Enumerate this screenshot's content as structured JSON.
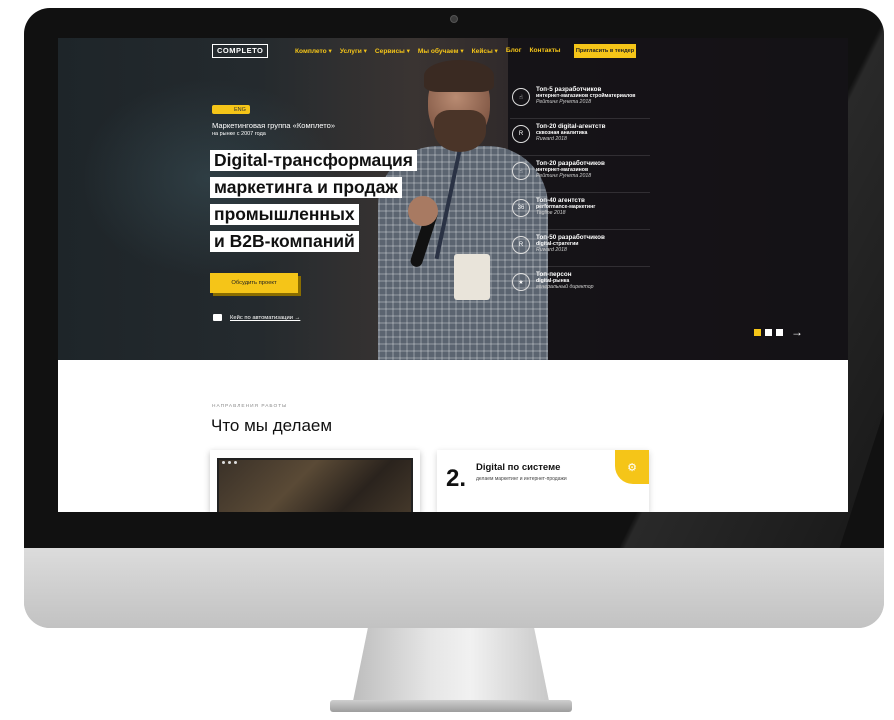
{
  "nav": {
    "logo": "COMPLETO",
    "items": [
      "Комплето ▾",
      "Услуги ▾",
      "Сервисы ▾",
      "Мы обучаем ▾",
      "Кейсы ▾",
      "Блог",
      "Контакты"
    ],
    "cta": "Пригласить в тендер"
  },
  "hero": {
    "lang": "ENG",
    "tagline": "Маркетинговая группа «Комплето»",
    "since": "на рынке с 2007 года",
    "headline": [
      "Digital-трансформация",
      "маркетинга и продаж",
      "промышленных",
      "и B2B-компаний"
    ],
    "cta": "Обсудить проект",
    "case_link": "Кейс по автоматизации →"
  },
  "awards": [
    {
      "icon": "hand-award-icon",
      "glyph": "☝",
      "title": "Топ-5 разработчиков",
      "desc": "интернет-магазинов стройматериалов",
      "src": "Рейтинг Рунета 2018"
    },
    {
      "icon": "ruward-icon",
      "glyph": "R",
      "title": "Топ-20 digital-агентств",
      "desc": "сквозная аналитика",
      "src": "Ruward 2018"
    },
    {
      "icon": "hand-award-icon",
      "glyph": "☝",
      "title": "Топ-20 разработчиков",
      "desc": "интернет-магазинов",
      "src": "Рейтинг Рунета 2018"
    },
    {
      "icon": "tagline-36-icon",
      "glyph": "36",
      "title": "Топ-40 агентств",
      "desc": "performance-маркетинг",
      "src": "Tagline 2018"
    },
    {
      "icon": "ruward-icon",
      "glyph": "R",
      "title": "Топ-50 разработчиков",
      "desc": "digital-стратегии",
      "src": "Ruward 2018"
    },
    {
      "icon": "laurel-icon",
      "glyph": "★",
      "title": "Топ-персон",
      "desc": "digital-рынка",
      "src": "генеральный директор"
    }
  ],
  "section": {
    "eyebrow": "НАПРАВЛЕНИЯ РАБОТЫ",
    "title": "Что мы делаем"
  },
  "card2": {
    "number": "2.",
    "title": "Digital по системе",
    "subtitle": "делаем маркетинг и интернет-продажи",
    "corner_glyph": "⚙"
  },
  "slider": {
    "arrow": "→"
  },
  "colors": {
    "accent": "#f5c518",
    "hero_dark": "#1e1a20"
  }
}
